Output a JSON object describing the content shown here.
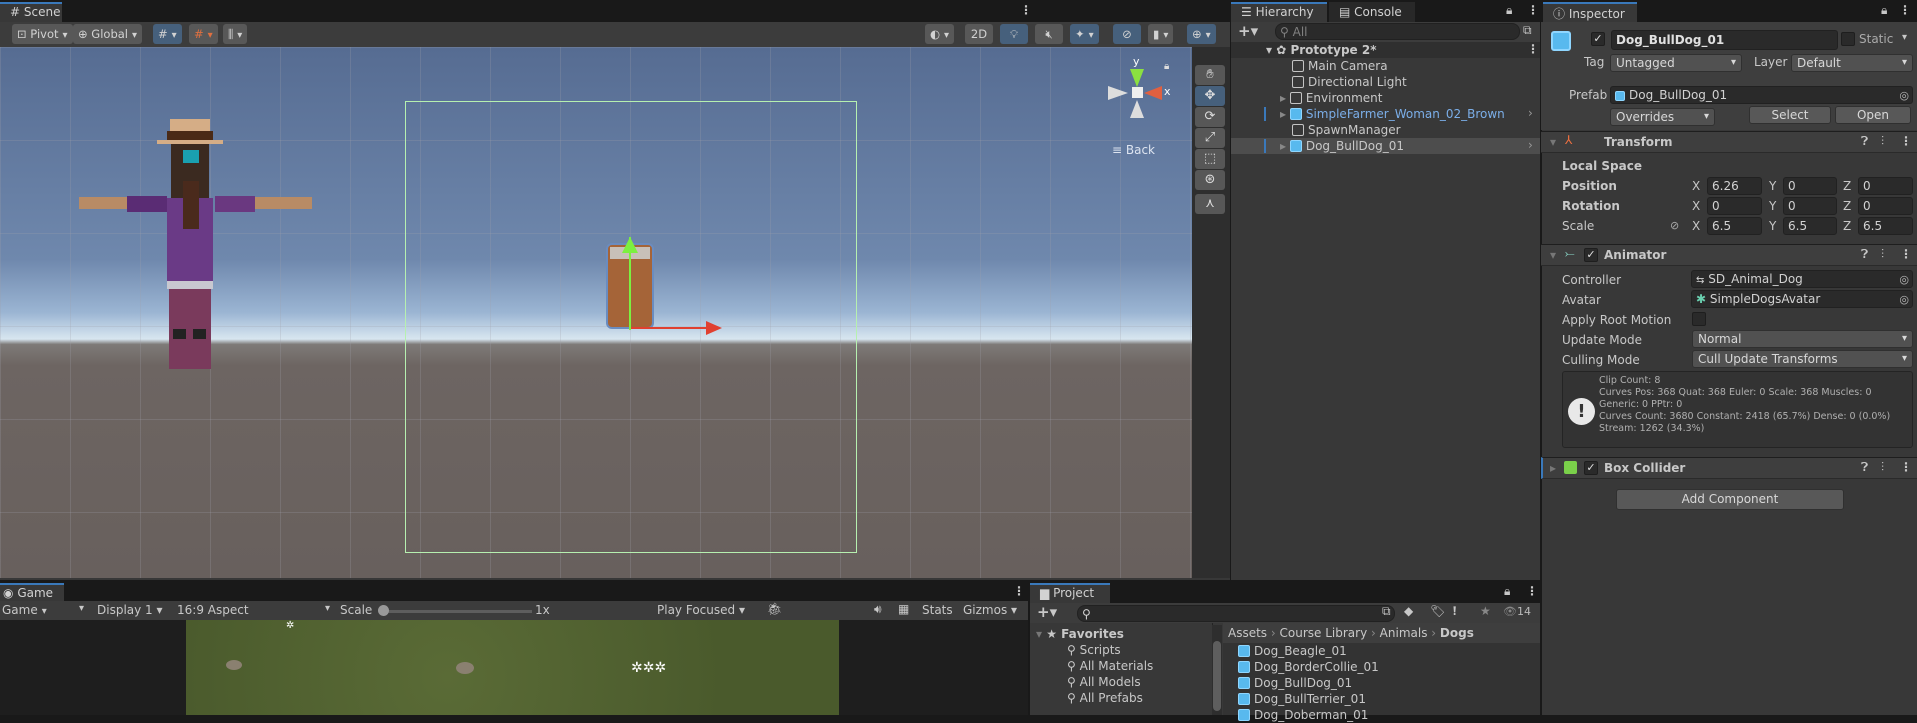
{
  "scene": {
    "tab": "Scene",
    "pivot": "Pivot",
    "global": "Global",
    "mode_2d": "2D",
    "gizmo_back": "Back",
    "axis_x": "x",
    "axis_y": "y"
  },
  "game": {
    "tab": "Game",
    "view": "Game",
    "display": "Display 1",
    "aspect": "16:9 Aspect",
    "scale_label": "Scale",
    "scale_value": "1x",
    "play_mode": "Play Focused",
    "stats": "Stats",
    "gizmos": "Gizmos"
  },
  "hierarchy": {
    "tab": "Hierarchy",
    "console_tab": "Console",
    "search_placeholder": "All",
    "scene_name": "Prototype 2*",
    "items": [
      {
        "label": "Main Camera"
      },
      {
        "label": "Directional Light"
      },
      {
        "label": "Environment"
      },
      {
        "label": "SimpleFarmer_Woman_02_Brown"
      },
      {
        "label": "SpawnManager"
      },
      {
        "label": "Dog_BullDog_01"
      }
    ]
  },
  "inspector": {
    "tab": "Inspector",
    "object_name": "Dog_BullDog_01",
    "static_label": "Static",
    "tag_label": "Tag",
    "tag_value": "Untagged",
    "layer_label": "Layer",
    "layer_value": "Default",
    "prefab_label": "Prefab",
    "prefab_value": "Dog_BullDog_01",
    "overrides": "Overrides",
    "select": "Select",
    "open": "Open",
    "transform": {
      "title": "Transform",
      "local_space": "Local Space",
      "position_label": "Position",
      "rotation_label": "Rotation",
      "scale_label": "Scale",
      "position": {
        "x": "6.26",
        "y": "0",
        "z": "0"
      },
      "rotation": {
        "x": "0",
        "y": "0",
        "z": "0"
      },
      "scale": {
        "x": "6.5",
        "y": "6.5",
        "z": "6.5"
      }
    },
    "animator": {
      "title": "Animator",
      "controller_label": "Controller",
      "controller_value": "SD_Animal_Dog",
      "avatar_label": "Avatar",
      "avatar_value": "SimpleDogsAvatar",
      "apply_root_motion_label": "Apply Root Motion",
      "update_mode_label": "Update Mode",
      "update_mode_value": "Normal",
      "culling_mode_label": "Culling Mode",
      "culling_mode_value": "Cull Update Transforms",
      "info": [
        "Clip Count: 8",
        "Curves Pos: 368 Quat: 368 Euler: 0 Scale: 368 Muscles: 0",
        "Generic: 0 PPtr: 0",
        "Curves Count: 3680 Constant: 2418 (65.7%) Dense: 0 (0.0%)",
        "Stream: 1262 (34.3%)"
      ]
    },
    "box_collider": {
      "title": "Box Collider"
    },
    "add_component": "Add Component"
  },
  "project": {
    "tab": "Project",
    "hidden_count": "14",
    "favorites": "Favorites",
    "favorite_items": [
      "Scripts",
      "All Materials",
      "All Models",
      "All Prefabs"
    ],
    "breadcrumb": [
      "Assets",
      "Course Library",
      "Animals",
      "Dogs"
    ],
    "assets": [
      "Dog_Beagle_01",
      "Dog_BorderCollie_01",
      "Dog_BullDog_01",
      "Dog_BullTerrier_01",
      "Dog_Doberman_01"
    ]
  }
}
